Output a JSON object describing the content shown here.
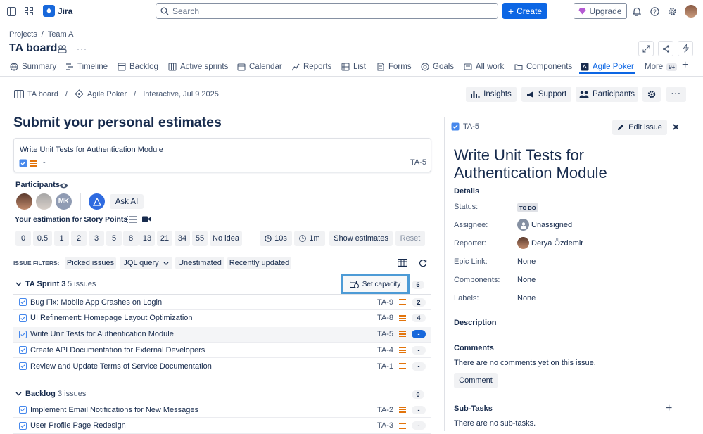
{
  "app": {
    "name": "Jira",
    "search_placeholder": "Search",
    "create": "Create",
    "upgrade": "Upgrade"
  },
  "breadcrumb": {
    "projects": "Projects",
    "sep": "/",
    "team": "Team A"
  },
  "board_title": "TA board",
  "tabs": [
    "Summary",
    "Timeline",
    "Backlog",
    "Active sprints",
    "Calendar",
    "Reports",
    "List",
    "Forms",
    "Goals",
    "All work",
    "Components",
    "Agile Poker",
    "More"
  ],
  "more_badge": "9+",
  "sub_breadcrumb": {
    "board": "TA board",
    "poker": "Agile Poker",
    "session": "Interactive, Jul 9 2025"
  },
  "actions": {
    "insights": "Insights",
    "support": "Support",
    "participants": "Participants"
  },
  "heading": "Submit your personal estimates",
  "current_issue": {
    "title": "Write Unit Tests for Authentication Module",
    "dash": "-",
    "key": "TA-5"
  },
  "participants_label": "Participants",
  "avatar_initials": "MK",
  "ask_ai": "Ask AI",
  "estimation_label": "Your estimation for Story Points",
  "cards": [
    "0",
    "0.5",
    "1",
    "2",
    "3",
    "5",
    "8",
    "13",
    "21",
    "34",
    "55",
    "No idea"
  ],
  "timers": [
    "10s",
    "1m"
  ],
  "show_estimates": "Show estimates",
  "reset": "Reset",
  "filters": {
    "label": "ISSUE FILTERS:",
    "items": [
      "Picked issues",
      "JQL query",
      "Unestimated",
      "Recently updated"
    ]
  },
  "set_capacity": "Set capacity",
  "sprint": {
    "name": "TA Sprint 3",
    "count": "5 issues",
    "total": "6",
    "issues": [
      {
        "title": "Bug Fix: Mobile App Crashes on Login",
        "key": "TA-9",
        "est": "2"
      },
      {
        "title": "UI Refinement: Homepage Layout Optimization",
        "key": "TA-8",
        "est": "4"
      },
      {
        "title": "Write Unit Tests for Authentication Module",
        "key": "TA-5",
        "est": "-"
      },
      {
        "title": "Create API Documentation for External Developers",
        "key": "TA-4",
        "est": "-"
      },
      {
        "title": "Review and Update Terms of Service Documentation",
        "key": "TA-1",
        "est": "-"
      }
    ]
  },
  "backlog": {
    "name": "Backlog",
    "count": "3 issues",
    "total": "0",
    "issues": [
      {
        "title": "Implement Email Notifications for New Messages",
        "key": "TA-2",
        "est": "-"
      },
      {
        "title": "User Profile Page Redesign",
        "key": "TA-3",
        "est": "-"
      }
    ]
  },
  "detail": {
    "key": "TA-5",
    "edit": "Edit issue",
    "title": "Write Unit Tests for Authentication Module",
    "details": "Details",
    "status_label": "Status:",
    "status": "TO DO",
    "assignee_label": "Assignee:",
    "assignee": "Unassigned",
    "reporter_label": "Reporter:",
    "reporter": "Derya Özdemir",
    "epic_label": "Epic Link:",
    "epic": "None",
    "components_label": "Components:",
    "components": "None",
    "labels_label": "Labels:",
    "labels": "None",
    "description": "Description",
    "comments": "Comments",
    "no_comments": "There are no comments yet on this issue.",
    "comment_btn": "Comment",
    "subtasks": "Sub-Tasks",
    "no_subtasks": "There are no sub-tasks."
  }
}
